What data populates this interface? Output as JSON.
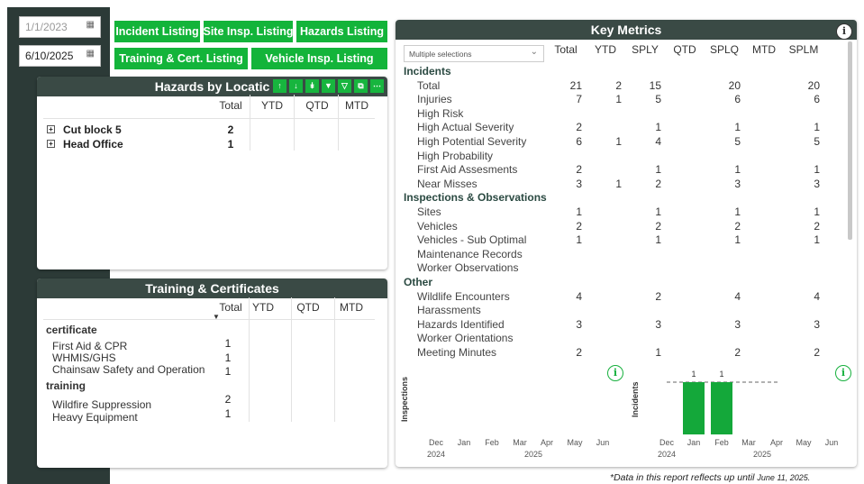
{
  "filters": {
    "start_date": "1/1/2023",
    "end_date": "6/10/2025",
    "calendar_icon": "calendar-icon"
  },
  "nav": {
    "incident_listing": "Incident Listing",
    "site_insp_listing": "Site Insp. Listing",
    "hazards_listing": "Hazards Listing",
    "training_cert_listing": "Training & Cert. Listing",
    "vehicle_insp_listing": "Vehicle Insp. Listing"
  },
  "hazards_panel": {
    "title": "Hazards by Locatic",
    "columns": [
      "Total",
      "YTD",
      "QTD",
      "MTD"
    ],
    "rows": [
      {
        "label": "Cut block 5",
        "total": "2",
        "ytd": "",
        "qtd": "",
        "mtd": ""
      },
      {
        "label": "Head Office",
        "total": "1",
        "ytd": "",
        "qtd": "",
        "mtd": ""
      }
    ],
    "toolbar_icons": [
      "arrow-up-icon",
      "arrow-down-icon",
      "double-arrow-down-icon",
      "expand-all-icon",
      "filter-icon",
      "focus-mode-icon",
      "more-options-icon"
    ]
  },
  "training_panel": {
    "title": "Training & Certificates",
    "columns": [
      "Total",
      "YTD",
      "QTD",
      "MTD"
    ],
    "sections": [
      {
        "label": "certificate",
        "items": [
          {
            "label": "First Aid & CPR",
            "total": "1"
          },
          {
            "label": "WHMIS/GHS",
            "total": "1"
          },
          {
            "label": "Chainsaw Safety and Operation",
            "total": "1"
          }
        ]
      },
      {
        "label": "training",
        "items": [
          {
            "label": "Wildfire Suppression",
            "total": "2"
          },
          {
            "label": "Heavy Equipment",
            "total": "1"
          }
        ]
      }
    ]
  },
  "key_metrics": {
    "title": "Key Metrics",
    "dropdown_label": "Multiple selections",
    "columns": [
      "Total",
      "YTD",
      "SPLY",
      "QTD",
      "SPLQ",
      "MTD",
      "SPLM"
    ],
    "rows": [
      {
        "label": "Incidents",
        "section": true,
        "vals": [
          "",
          "",
          "",
          "",
          "",
          "",
          ""
        ]
      },
      {
        "label": "Total",
        "section": false,
        "vals": [
          "21",
          "2",
          "15",
          "",
          "20",
          "",
          "20"
        ]
      },
      {
        "label": "Injuries",
        "section": false,
        "vals": [
          "7",
          "1",
          "5",
          "",
          "6",
          "",
          "6"
        ]
      },
      {
        "label": "High Risk",
        "section": false,
        "vals": [
          "",
          "",
          "",
          "",
          "",
          "",
          ""
        ]
      },
      {
        "label": "High Actual Severity",
        "section": false,
        "vals": [
          "2",
          "",
          "1",
          "",
          "1",
          "",
          "1"
        ]
      },
      {
        "label": "High Potential Severity",
        "section": false,
        "vals": [
          "6",
          "1",
          "4",
          "",
          "5",
          "",
          "5"
        ]
      },
      {
        "label": "High Probability",
        "section": false,
        "vals": [
          "",
          "",
          "",
          "",
          "",
          "",
          ""
        ]
      },
      {
        "label": "First Aid Assesments",
        "section": false,
        "vals": [
          "2",
          "",
          "1",
          "",
          "1",
          "",
          "1"
        ]
      },
      {
        "label": "Near Misses",
        "section": false,
        "vals": [
          "3",
          "1",
          "2",
          "",
          "3",
          "",
          "3"
        ]
      },
      {
        "label": "Inspections & Observations",
        "section": true,
        "vals": [
          "",
          "",
          "",
          "",
          "",
          "",
          ""
        ]
      },
      {
        "label": "Sites",
        "section": false,
        "vals": [
          "1",
          "",
          "1",
          "",
          "1",
          "",
          "1"
        ]
      },
      {
        "label": "Vehicles",
        "section": false,
        "vals": [
          "2",
          "",
          "2",
          "",
          "2",
          "",
          "2"
        ]
      },
      {
        "label": "Vehicles - Sub Optimal",
        "section": false,
        "vals": [
          "1",
          "",
          "1",
          "",
          "1",
          "",
          "1"
        ]
      },
      {
        "label": "Maintenance Records",
        "section": false,
        "vals": [
          "",
          "",
          "",
          "",
          "",
          "",
          ""
        ]
      },
      {
        "label": "Worker Observations",
        "section": false,
        "vals": [
          "",
          "",
          "",
          "",
          "",
          "",
          ""
        ]
      },
      {
        "label": "Other",
        "section": true,
        "vals": [
          "",
          "",
          "",
          "",
          "",
          "",
          ""
        ]
      },
      {
        "label": "Wildlife Encounters",
        "section": false,
        "vals": [
          "4",
          "",
          "2",
          "",
          "4",
          "",
          "4"
        ]
      },
      {
        "label": "Harassments",
        "section": false,
        "vals": [
          "",
          "",
          "",
          "",
          "",
          "",
          ""
        ]
      },
      {
        "label": "Hazards Identified",
        "section": false,
        "vals": [
          "3",
          "",
          "3",
          "",
          "3",
          "",
          "3"
        ]
      },
      {
        "label": "Worker Orientations",
        "section": false,
        "vals": [
          "",
          "",
          "",
          "",
          "",
          "",
          ""
        ]
      },
      {
        "label": "Meeting Minutes",
        "section": false,
        "vals": [
          "2",
          "",
          "1",
          "",
          "2",
          "",
          "2"
        ]
      }
    ]
  },
  "chart_data": [
    {
      "type": "bar",
      "ylabel": "Inspections",
      "categories": [
        "Dec",
        "Jan",
        "Feb",
        "Mar",
        "Apr",
        "May",
        "Jun"
      ],
      "year_labels": [
        "2024",
        "2025"
      ],
      "values": [
        0,
        0,
        0,
        0,
        0,
        0,
        0
      ]
    },
    {
      "type": "bar",
      "ylabel": "Incidents",
      "categories": [
        "Dec",
        "Jan",
        "Feb",
        "Mar",
        "Apr",
        "May",
        "Jun"
      ],
      "year_labels": [
        "2024",
        "2025"
      ],
      "values": [
        0,
        1,
        1,
        0,
        0,
        0,
        0
      ],
      "data_labels": [
        "1",
        "1"
      ],
      "reference_line": true,
      "bar_color": "#14a83a"
    }
  ],
  "footnote": {
    "text": "*Data in this report reflects up until",
    "date": "June 11, 2025."
  },
  "colors": {
    "accent_green": "#13b43a",
    "header_dark": "#3a4a45",
    "sidebar_dark": "#2c3a37"
  }
}
